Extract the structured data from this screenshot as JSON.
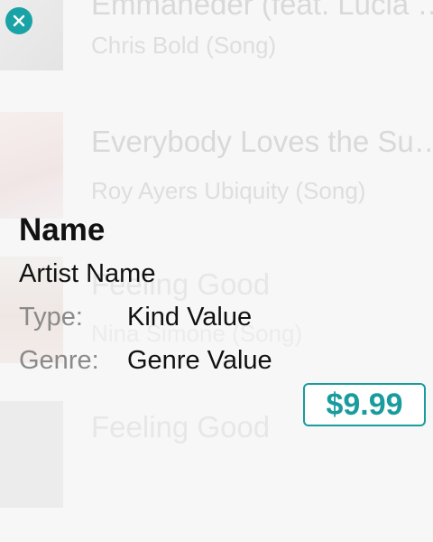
{
  "background_list": [
    {
      "title": "Emmaneder (feat. Lucia …",
      "subtitle": "Chris Bold (Song)"
    },
    {
      "title": "Everybody Loves the Su…",
      "subtitle": "Roy Ayers Ubiquity (Song)"
    },
    {
      "title": "Feeling Good",
      "subtitle": "Nina Simone (Song)"
    },
    {
      "title": "Feeling Good",
      "subtitle": ""
    }
  ],
  "detail": {
    "name": "Name",
    "artist": "Artist Name",
    "type_label": "Type:",
    "type_value": "Kind Value",
    "genre_label": "Genre:",
    "genre_value": "Genre Value"
  },
  "price": {
    "label": "$9.99"
  },
  "colors": {
    "accent": "#1aa3a6",
    "background": "#f7f7f7",
    "primary_text": "#111111",
    "secondary_text": "#8a8a8a"
  },
  "icons": {
    "close": "close-icon"
  }
}
